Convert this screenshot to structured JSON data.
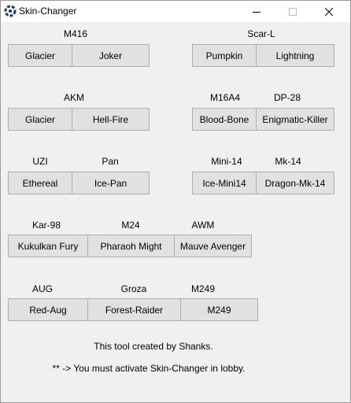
{
  "window": {
    "title": "Skin-Changer",
    "icon": "cheat-engine-icon"
  },
  "groups": {
    "m416": {
      "label": "M416",
      "buttons": [
        "Glacier",
        "Joker"
      ]
    },
    "scarl": {
      "label": "Scar-L",
      "buttons": [
        "Pumpkin",
        "Lightning"
      ]
    },
    "akm": {
      "label": "AKM",
      "buttons": [
        "Glacier",
        "Hell-Fire"
      ]
    },
    "m16a4": {
      "label": "M16A4",
      "buttons": [
        "Blood-Bone"
      ]
    },
    "dp28": {
      "label": "DP-28",
      "buttons": [
        "Enigmatic-Killer"
      ]
    },
    "uzi": {
      "label": "UZI",
      "buttons": [
        "Ethereal"
      ]
    },
    "pan": {
      "label": "Pan",
      "buttons": [
        "Ice-Pan"
      ]
    },
    "mini14": {
      "label": "Mini-14",
      "buttons": [
        "Ice-Mini14"
      ]
    },
    "mk14": {
      "label": "Mk-14",
      "buttons": [
        "Dragon-Mk-14"
      ]
    },
    "kar98": {
      "label": "Kar-98",
      "buttons": [
        "Kukulkan Fury"
      ]
    },
    "m24": {
      "label": "M24",
      "buttons": [
        "Pharaoh Might"
      ]
    },
    "awm": {
      "label": "AWM",
      "buttons": [
        "Mauve Avenger"
      ]
    },
    "aug": {
      "label": "AUG",
      "buttons": [
        "Red-Aug"
      ]
    },
    "groza": {
      "label": "Groza",
      "buttons": [
        "Forest-Raider"
      ]
    },
    "m249": {
      "label": "M249",
      "buttons": [
        "M249"
      ]
    }
  },
  "footer": {
    "credit": "This tool created by Shanks.",
    "note": "** -> You must activate Skin-Changer in lobby."
  }
}
